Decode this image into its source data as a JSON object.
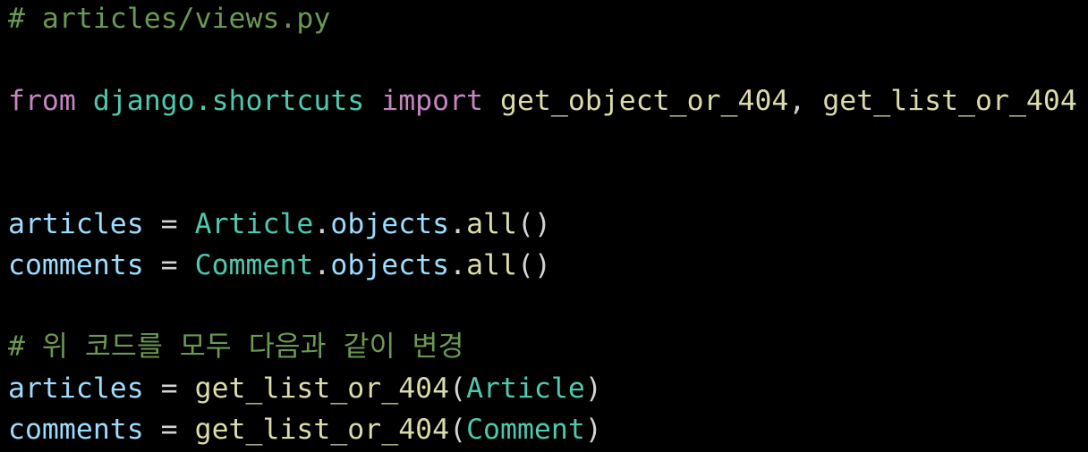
{
  "code": {
    "line1": {
      "comment": "# articles/views.py"
    },
    "line3": {
      "kw_from": "from",
      "module": "django.shortcuts",
      "kw_import": "import",
      "name1": "get_object_or_404",
      "sep": ", ",
      "name2": "get_list_or_404"
    },
    "line6": {
      "var": "articles",
      "eq": " = ",
      "cls": "Article",
      "dot1": ".",
      "attr": "objects",
      "dot2": ".",
      "method": "all",
      "parens": "()"
    },
    "line7": {
      "var": "comments",
      "eq": " = ",
      "cls": "Comment",
      "dot1": ".",
      "attr": "objects",
      "dot2": ".",
      "method": "all",
      "parens": "()"
    },
    "line9": {
      "comment": "# 위 코드를 모두 다음과 같이 변경"
    },
    "line10": {
      "var": "articles",
      "eq": " = ",
      "func": "get_list_or_404",
      "open": "(",
      "arg": "Article",
      "close": ")"
    },
    "line11": {
      "var": "comments",
      "eq": " = ",
      "func": "get_list_or_404",
      "open": "(",
      "arg": "Comment",
      "close": ")"
    }
  },
  "colors": {
    "background": "#000000",
    "comment": "#6a9955",
    "keyword": "#c586c0",
    "module": "#4ec9b0",
    "function": "#dcdcaa",
    "variable": "#9cdcfe",
    "plain": "#d4d4d4"
  }
}
